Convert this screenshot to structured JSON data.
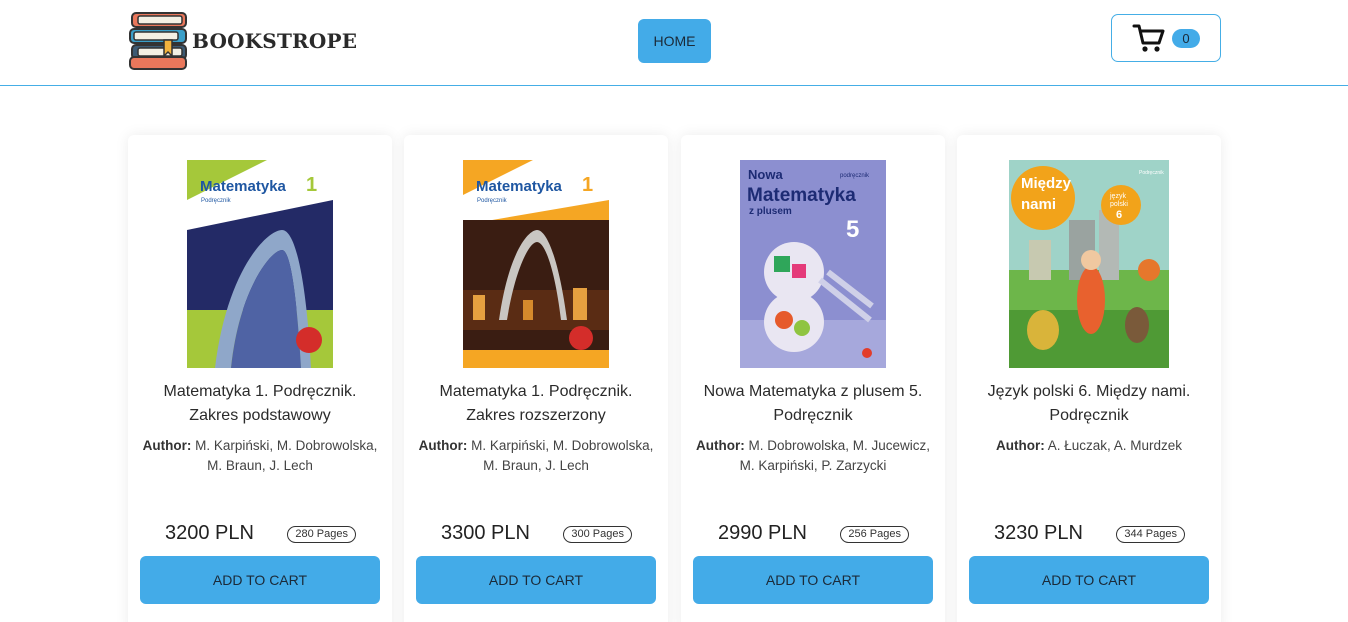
{
  "header": {
    "logo_text": "BOOKSTROPE",
    "nav": {
      "home_label": "HOME"
    },
    "cart": {
      "count": "0"
    }
  },
  "colors": {
    "accent": "#43abe8",
    "border": "#45aee6"
  },
  "products": [
    {
      "title": "Matematyka 1. Podręcznik. Zakres podstawowy",
      "author_label": "Author:",
      "authors": "M. Karpiński, M. Dobrowolska, M. Braun, J. Lech",
      "price": "3200 PLN",
      "pages": "280 Pages",
      "cover": {
        "heading": "Matematyka",
        "number": "1",
        "sub": "Podręcznik"
      },
      "button": "ADD TO CART"
    },
    {
      "title": "Matematyka 1. Podręcznik. Zakres rozszerzony",
      "author_label": "Author:",
      "authors": "M. Karpiński, M. Dobrowolska, M. Braun, J. Lech",
      "price": "3300 PLN",
      "pages": "300 Pages",
      "cover": {
        "heading": "Matematyka",
        "number": "1",
        "sub": "Podręcznik"
      },
      "button": "ADD TO CART"
    },
    {
      "title": "Nowa Matematyka z plusem 5. Podręcznik",
      "author_label": "Author:",
      "authors": "M. Dobrowolska, M. Jucewicz, M. Karpiński, P. Zarzycki",
      "price": "2990 PLN",
      "pages": "256 Pages",
      "cover": {
        "line1": "Nowa",
        "heading": "Matematyka",
        "line3": "z plusem",
        "number": "5",
        "tag": "podręcznik"
      },
      "button": "ADD TO CART"
    },
    {
      "title": "Język polski 6. Między nami. Podręcznik",
      "author_label": "Author:",
      "authors": "A. Łuczak, A. Murdzek",
      "price": "3230 PLN",
      "pages": "344 Pages",
      "cover": {
        "heading1": "Między",
        "heading2": "nami",
        "badge1": "język",
        "badge2": "polski",
        "number": "6",
        "tag": "Podręcznik"
      },
      "button": "ADD TO CART"
    }
  ]
}
